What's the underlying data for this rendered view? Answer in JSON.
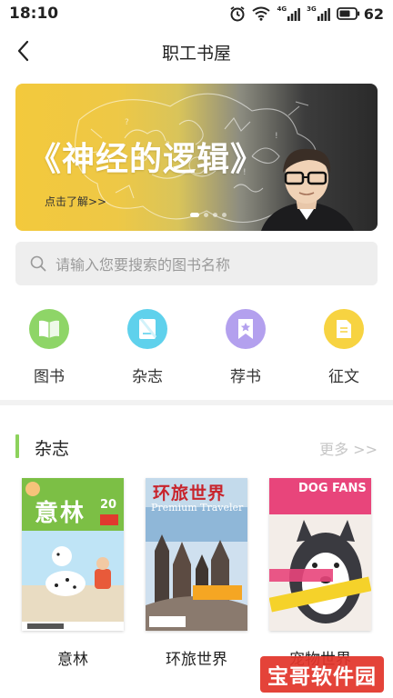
{
  "status_bar": {
    "time": "18:10",
    "sim1_label": "4G",
    "sim2_label": "3G",
    "battery_level": "62",
    "icons": [
      "alarm-icon",
      "wifi-icon",
      "signal-icon",
      "signal-icon",
      "battery-icon"
    ]
  },
  "header": {
    "title": "职工书屋",
    "back_icon": "chevron-left-icon"
  },
  "banner": {
    "title": "《神经的逻辑》",
    "link_text": "点击了解>>",
    "slide_count": 4,
    "active_slide": 1
  },
  "search": {
    "placeholder": "请输入您要搜索的图书名称",
    "icon": "search-icon"
  },
  "categories": [
    {
      "label": "图书",
      "icon": "book-icon",
      "color": "#8ed567"
    },
    {
      "label": "杂志",
      "icon": "magazine-icon",
      "color": "#5fd1ec"
    },
    {
      "label": "荐书",
      "icon": "bookmark-star-icon",
      "color": "#b3a0ee"
    },
    {
      "label": "征文",
      "icon": "document-icon",
      "color": "#f7d341"
    }
  ],
  "magazine_section": {
    "title": "杂志",
    "more_label": "更多 >>",
    "accent_color": "#8dd25c",
    "items": [
      {
        "title": "意林",
        "cover_text": "意林",
        "issue": "20"
      },
      {
        "title": "环旅世界",
        "cover_text": "环旅世界",
        "cover_subtitle": "Premium Traveler"
      },
      {
        "title": "宠物世界",
        "cover_text": "DOG FANS"
      }
    ]
  },
  "watermark": {
    "text": "宝哥软件园"
  }
}
